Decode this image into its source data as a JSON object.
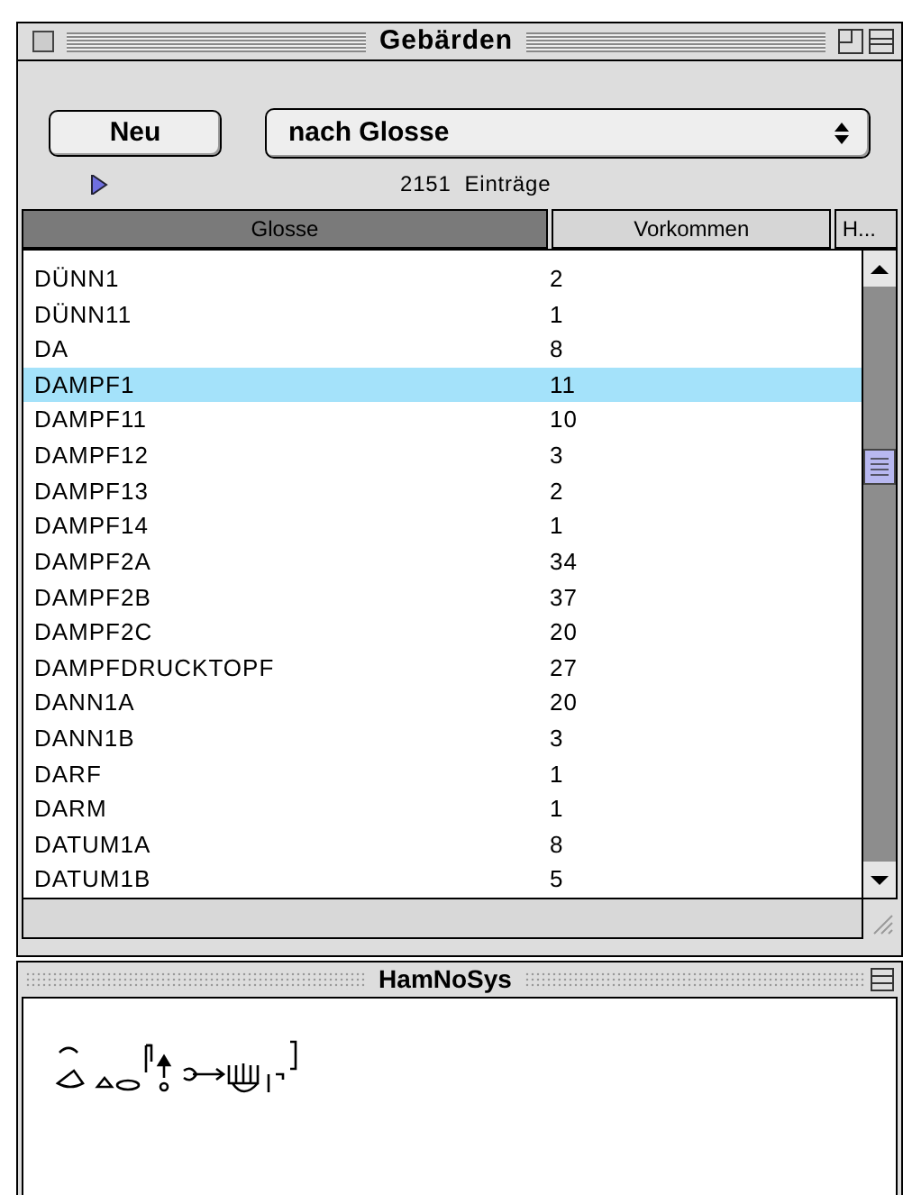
{
  "window": {
    "title": "Gebärden"
  },
  "new_button": {
    "label": "Neu"
  },
  "sort_popup": {
    "value": "nach Glosse"
  },
  "disclosure": {
    "expanded": false
  },
  "entry_count": "2151  Einträge",
  "table": {
    "columns": [
      {
        "label": "Glosse",
        "selected": true
      },
      {
        "label": "Vorkommen",
        "selected": false
      },
      {
        "label": "H...",
        "selected": false
      }
    ],
    "rows": [
      {
        "glosse": "DÜNN1",
        "vorkommen": "2",
        "selected": false
      },
      {
        "glosse": "DÜNN11",
        "vorkommen": "1",
        "selected": false
      },
      {
        "glosse": "DA",
        "vorkommen": "8",
        "selected": false
      },
      {
        "glosse": "DAMPF1",
        "vorkommen": "11",
        "selected": true
      },
      {
        "glosse": "DAMPF11",
        "vorkommen": "10",
        "selected": false
      },
      {
        "glosse": "DAMPF12",
        "vorkommen": "3",
        "selected": false
      },
      {
        "glosse": "DAMPF13",
        "vorkommen": "2",
        "selected": false
      },
      {
        "glosse": "DAMPF14",
        "vorkommen": "1",
        "selected": false
      },
      {
        "glosse": "DAMPF2A",
        "vorkommen": "34",
        "selected": false
      },
      {
        "glosse": "DAMPF2B",
        "vorkommen": "37",
        "selected": false
      },
      {
        "glosse": "DAMPF2C",
        "vorkommen": "20",
        "selected": false
      },
      {
        "glosse": "DAMPFDRUCKTOPF",
        "vorkommen": "27",
        "selected": false
      },
      {
        "glosse": "DANN1A",
        "vorkommen": "20",
        "selected": false
      },
      {
        "glosse": "DANN1B",
        "vorkommen": "3",
        "selected": false
      },
      {
        "glosse": "DARF",
        "vorkommen": "1",
        "selected": false
      },
      {
        "glosse": "DARM",
        "vorkommen": "1",
        "selected": false
      },
      {
        "glosse": "DATUM1A",
        "vorkommen": "8",
        "selected": false
      },
      {
        "glosse": "DATUM1B",
        "vorkommen": "5",
        "selected": false
      }
    ]
  },
  "hamnosys_window": {
    "title": "HamNoSys"
  }
}
